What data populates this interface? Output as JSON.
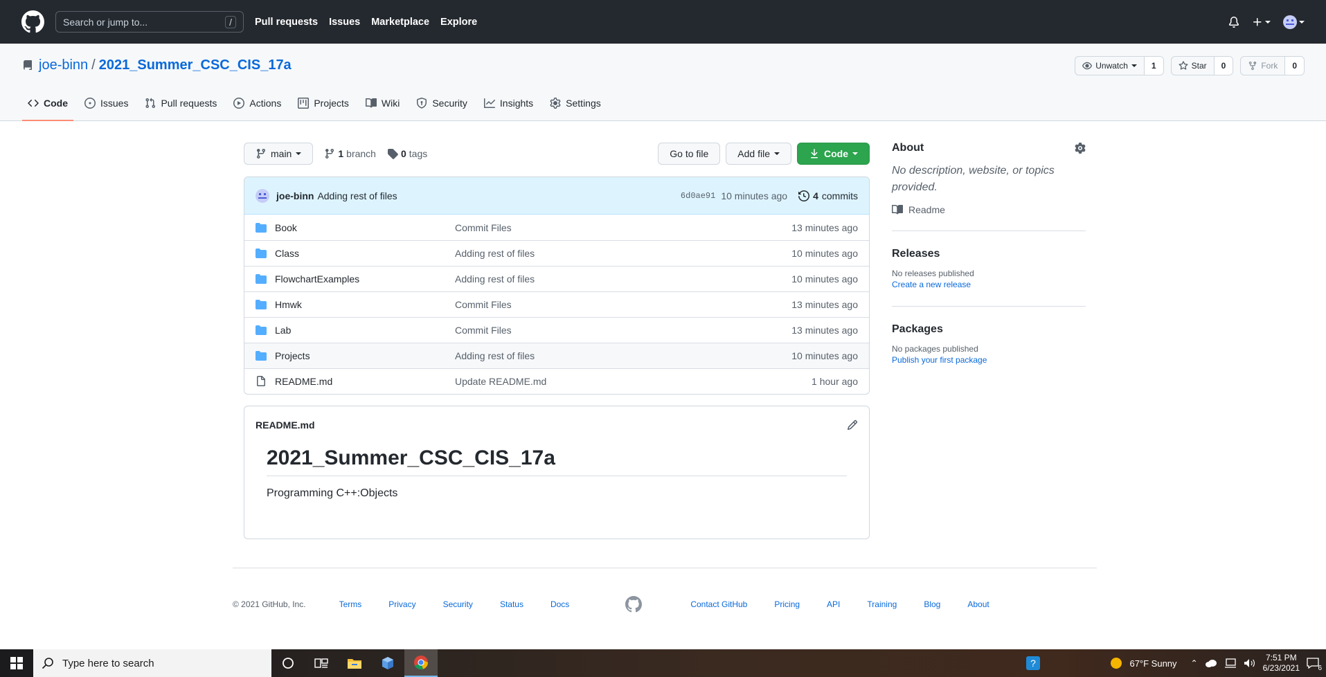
{
  "header": {
    "search_placeholder": "Search or jump to...",
    "slash_key": "/",
    "nav": [
      "Pull requests",
      "Issues",
      "Marketplace",
      "Explore"
    ]
  },
  "repo": {
    "owner": "joe-binn",
    "separator": "/",
    "name": "2021_Summer_CSC_CIS_17a",
    "watch_label": "Unwatch",
    "watch_count": "1",
    "star_label": "Star",
    "star_count": "0",
    "fork_label": "Fork",
    "fork_count": "0"
  },
  "tabs": [
    {
      "label": "Code",
      "icon": "code-icon",
      "selected": true
    },
    {
      "label": "Issues",
      "icon": "issue-icon"
    },
    {
      "label": "Pull requests",
      "icon": "pull-request-icon"
    },
    {
      "label": "Actions",
      "icon": "play-icon"
    },
    {
      "label": "Projects",
      "icon": "project-icon"
    },
    {
      "label": "Wiki",
      "icon": "book-icon"
    },
    {
      "label": "Security",
      "icon": "shield-icon"
    },
    {
      "label": "Insights",
      "icon": "graph-icon"
    },
    {
      "label": "Settings",
      "icon": "gear-icon"
    }
  ],
  "toolbar": {
    "branch": "main",
    "branch_count": "1",
    "branch_word": "branch",
    "tag_count": "0",
    "tag_word": "tags",
    "go_to_file": "Go to file",
    "add_file": "Add file",
    "code": "Code"
  },
  "latest_commit": {
    "author": "joe-binn",
    "message": "Adding rest of files",
    "sha": "6d0ae91",
    "time": "10 minutes ago",
    "commit_count": "4",
    "commit_word": "commits"
  },
  "files": [
    {
      "type": "dir",
      "name": "Book",
      "message": "Commit Files",
      "age": "13 minutes ago"
    },
    {
      "type": "dir",
      "name": "Class",
      "message": "Adding rest of files",
      "age": "10 minutes ago"
    },
    {
      "type": "dir",
      "name": "FlowchartExamples",
      "message": "Adding rest of files",
      "age": "10 minutes ago"
    },
    {
      "type": "dir",
      "name": "Hmwk",
      "message": "Commit Files",
      "age": "13 minutes ago"
    },
    {
      "type": "dir",
      "name": "Lab",
      "message": "Commit Files",
      "age": "13 minutes ago"
    },
    {
      "type": "dir",
      "name": "Projects",
      "message": "Adding rest of files",
      "age": "10 minutes ago"
    },
    {
      "type": "file",
      "name": "README.md",
      "message": "Update README.md",
      "age": "1 hour ago"
    }
  ],
  "readme": {
    "filename": "README.md",
    "heading": "2021_Summer_CSC_CIS_17a",
    "body": "Programming C++:Objects"
  },
  "sidebar": {
    "about_title": "About",
    "about_desc": "No description, website, or topics provided.",
    "readme_link": "Readme",
    "releases_title": "Releases",
    "releases_none": "No releases published",
    "releases_link": "Create a new release",
    "packages_title": "Packages",
    "packages_none": "No packages published",
    "packages_link": "Publish your first package"
  },
  "footer": {
    "copyright": "© 2021 GitHub, Inc.",
    "links_left": [
      "Terms",
      "Privacy",
      "Security",
      "Status",
      "Docs"
    ],
    "links_right": [
      "Contact GitHub",
      "Pricing",
      "API",
      "Training",
      "Blog",
      "About"
    ]
  },
  "taskbar": {
    "search_placeholder": "Type here to search",
    "weather": "67°F  Sunny",
    "time": "7:51 PM",
    "date": "6/23/2021",
    "notification_count": "6"
  },
  "colors": {
    "header_bg": "#24292f",
    "link": "#0969da",
    "green_button": "#2da44e",
    "folder": "#54aeff",
    "tab_underline": "#fd8c73"
  }
}
